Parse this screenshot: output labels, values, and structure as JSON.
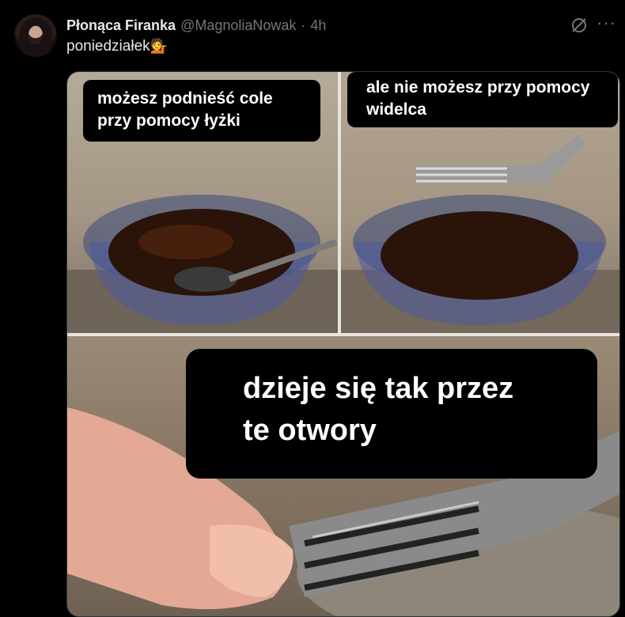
{
  "author": {
    "display_name": "Płonąca Firanka",
    "handle": "@MagnoliaNowak",
    "separator": "·",
    "time_ago": "4h"
  },
  "tweet": {
    "text": "poniedziałek",
    "emoji": "💁"
  },
  "actions": {
    "grok_icon": "grok-icon",
    "more_label": "···"
  },
  "media": {
    "caption_top_left": "możesz podnieść cole przy pomocy łyżki",
    "caption_top_right": "ale nie możesz przy pomocy widelca",
    "caption_bottom": "dzieje się tak przez te otwory"
  }
}
